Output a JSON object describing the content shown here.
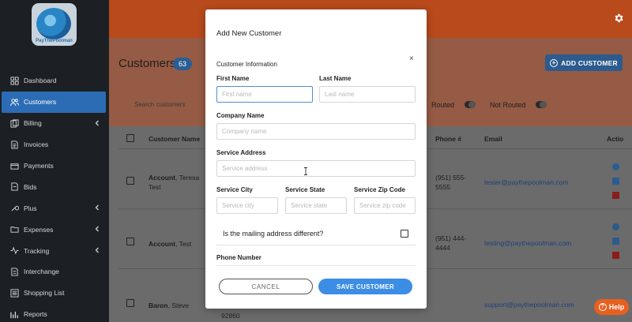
{
  "app": {
    "logo_text": "PayThePoolman"
  },
  "sidebar": {
    "items": [
      {
        "label": "Dashboard",
        "icon": "dashboard-icon",
        "active": false,
        "expandable": false
      },
      {
        "label": "Customers",
        "icon": "users-icon",
        "active": true,
        "expandable": false
      },
      {
        "label": "Billing",
        "icon": "billing-icon",
        "active": false,
        "expandable": true
      },
      {
        "label": "Invoices",
        "icon": "invoice-icon",
        "active": false,
        "expandable": false
      },
      {
        "label": "Payments",
        "icon": "payments-icon",
        "active": false,
        "expandable": false
      },
      {
        "label": "Bids",
        "icon": "bids-icon",
        "active": false,
        "expandable": false
      },
      {
        "label": "Plus",
        "icon": "wrench-icon",
        "active": false,
        "expandable": true
      },
      {
        "label": "Expenses",
        "icon": "folder-icon",
        "active": false,
        "expandable": true
      },
      {
        "label": "Tracking",
        "icon": "activity-icon",
        "active": false,
        "expandable": true
      },
      {
        "label": "Interchange",
        "icon": "interchange-icon",
        "active": false,
        "expandable": false
      },
      {
        "label": "Shopping List",
        "icon": "list-icon",
        "active": false,
        "expandable": false
      },
      {
        "label": "Reports",
        "icon": "reports-icon",
        "active": false,
        "expandable": false
      }
    ]
  },
  "page": {
    "title": "Customers",
    "count": "63",
    "add_button": "ADD CUSTOMER",
    "search_placeholder": "Search customers",
    "routed_label": "Routed",
    "not_routed_label": "Not Routed"
  },
  "table": {
    "headers": {
      "name": "Customer Name",
      "phone": "Phone #",
      "email": "Email",
      "actions": "Actio"
    },
    "rows": [
      {
        "last": "Account",
        "first": ", Teresa",
        "first2": "Test",
        "phone": "(951) 555-",
        "phone2": "5555",
        "email": "tester@paythepoolman.com"
      },
      {
        "last": "Account",
        "first": ", Test",
        "first2": "",
        "phone": "(951) 444-",
        "phone2": "4444",
        "email": "testing@paythepoolman.com"
      },
      {
        "last": "Baron",
        "first": ", Steve",
        "first2": "",
        "phone": "",
        "phone2": "",
        "email": "support@paythepoolman.com"
      }
    ],
    "partial_zip": "92860"
  },
  "modal": {
    "title": "Add New Customer",
    "close": "×",
    "section": "Customer Information",
    "first_name_label": "First Name",
    "first_name_placeholder": "First name",
    "last_name_label": "Last Name",
    "last_name_placeholder": "Last name",
    "company_label": "Company Name",
    "company_placeholder": "Company name",
    "address_label": "Service Address",
    "address_placeholder": "Service address",
    "city_label": "Service City",
    "city_placeholder": "Service city",
    "state_label": "Service State",
    "state_placeholder": "Service state",
    "zip_label": "Service Zip Code",
    "zip_placeholder": "Service zip code",
    "mailing_question": "Is the mailing address different?",
    "phone_label": "Phone Number",
    "cancel": "CANCEL",
    "save": "SAVE CUSTOMER"
  },
  "help": {
    "label": "Help"
  },
  "colors": {
    "accent": "#3b8de6",
    "sidebar_bg": "#1c2024",
    "topbar": "#b84a1c",
    "help": "#e8601f"
  }
}
